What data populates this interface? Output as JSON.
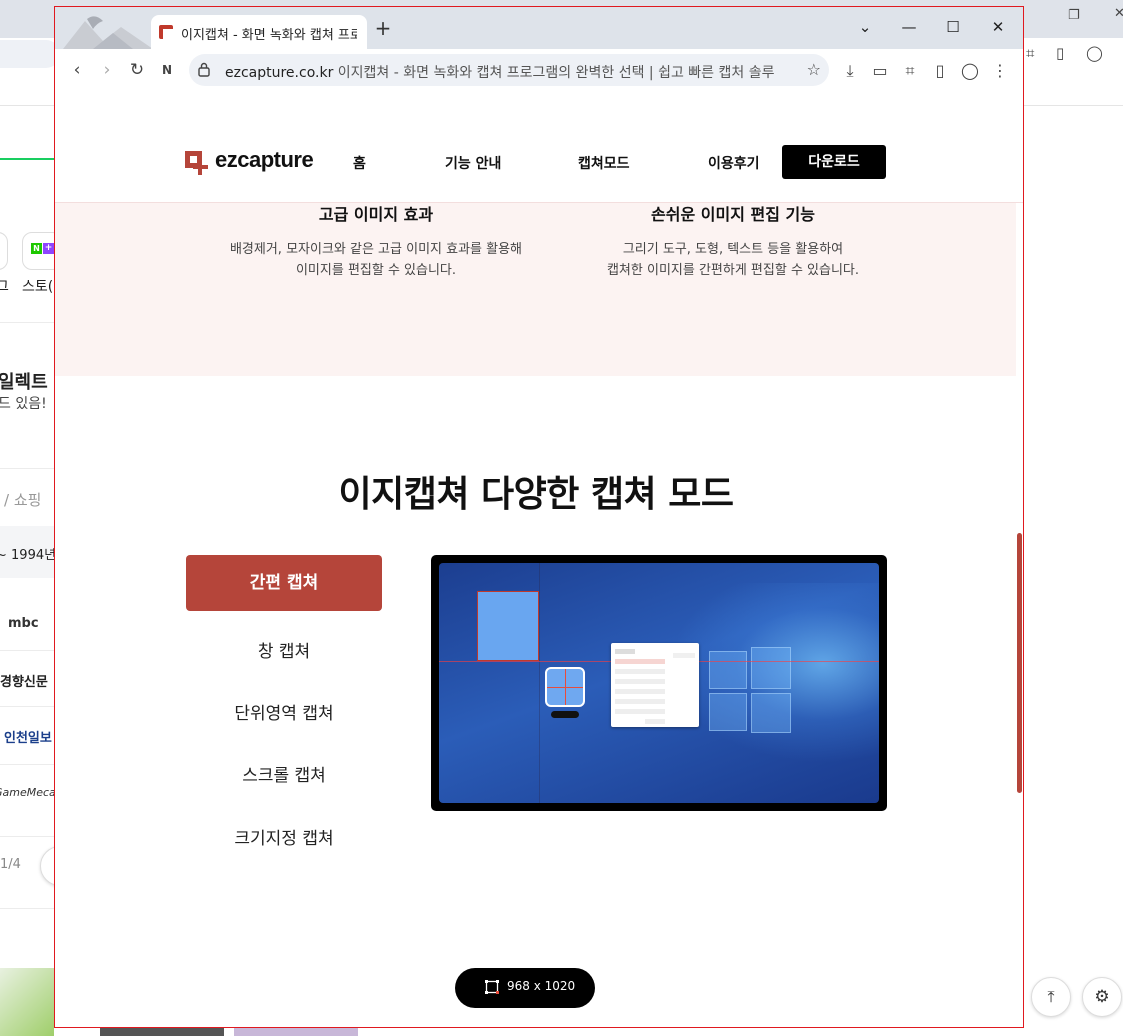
{
  "background": {
    "partial_texts": [
      "그",
      "스토(",
      "일렉트",
      "드 있음!",
      "/ 쇼핑",
      "~ 1994년",
      "mbc",
      "경향신문",
      "인천일보",
      "GameMeca",
      "1/4"
    ],
    "tile_n": "N",
    "tile_plus": "+"
  },
  "browser": {
    "tab_title": "이지캡쳐 - 화면 녹화와 캡쳐 프로",
    "new_tab": "+",
    "url_host": "ezcapture.co.kr",
    "url_rest": "이지캡쳐 - 화면 녹화와 캡쳐 프로그램의 완벽한 선택 | 쉽고 빠른 캡처 솔루"
  },
  "site": {
    "logo_text": "ezcapture",
    "nav": [
      "홈",
      "기능 안내",
      "캡쳐모드",
      "이용후기"
    ],
    "download_label": "다운로드",
    "features": [
      {
        "title": "고급 이미지 효과",
        "desc1": "배경제거, 모자이크와 같은 고급 이미지 효과를 활용해",
        "desc2": "이미지를 편집할 수 있습니다."
      },
      {
        "title": "손쉬운 이미지 편집 기능",
        "desc1": "그리기 도구, 도형, 텍스트 등을 활용하여",
        "desc2": "캡쳐한 이미지를 간편하게 편집할 수 있습니다."
      }
    ],
    "section_title": "이지캡쳐 다양한 캡쳐 모드",
    "modes": [
      "간편 캡쳐",
      "창 캡쳐",
      "단위영역 캡쳐",
      "스크롤 캡쳐",
      "크기지정 캡쳐"
    ],
    "active_mode_index": 0,
    "accent_color": "#b5453a"
  },
  "overlay": {
    "size_label": "968 x 1020"
  }
}
